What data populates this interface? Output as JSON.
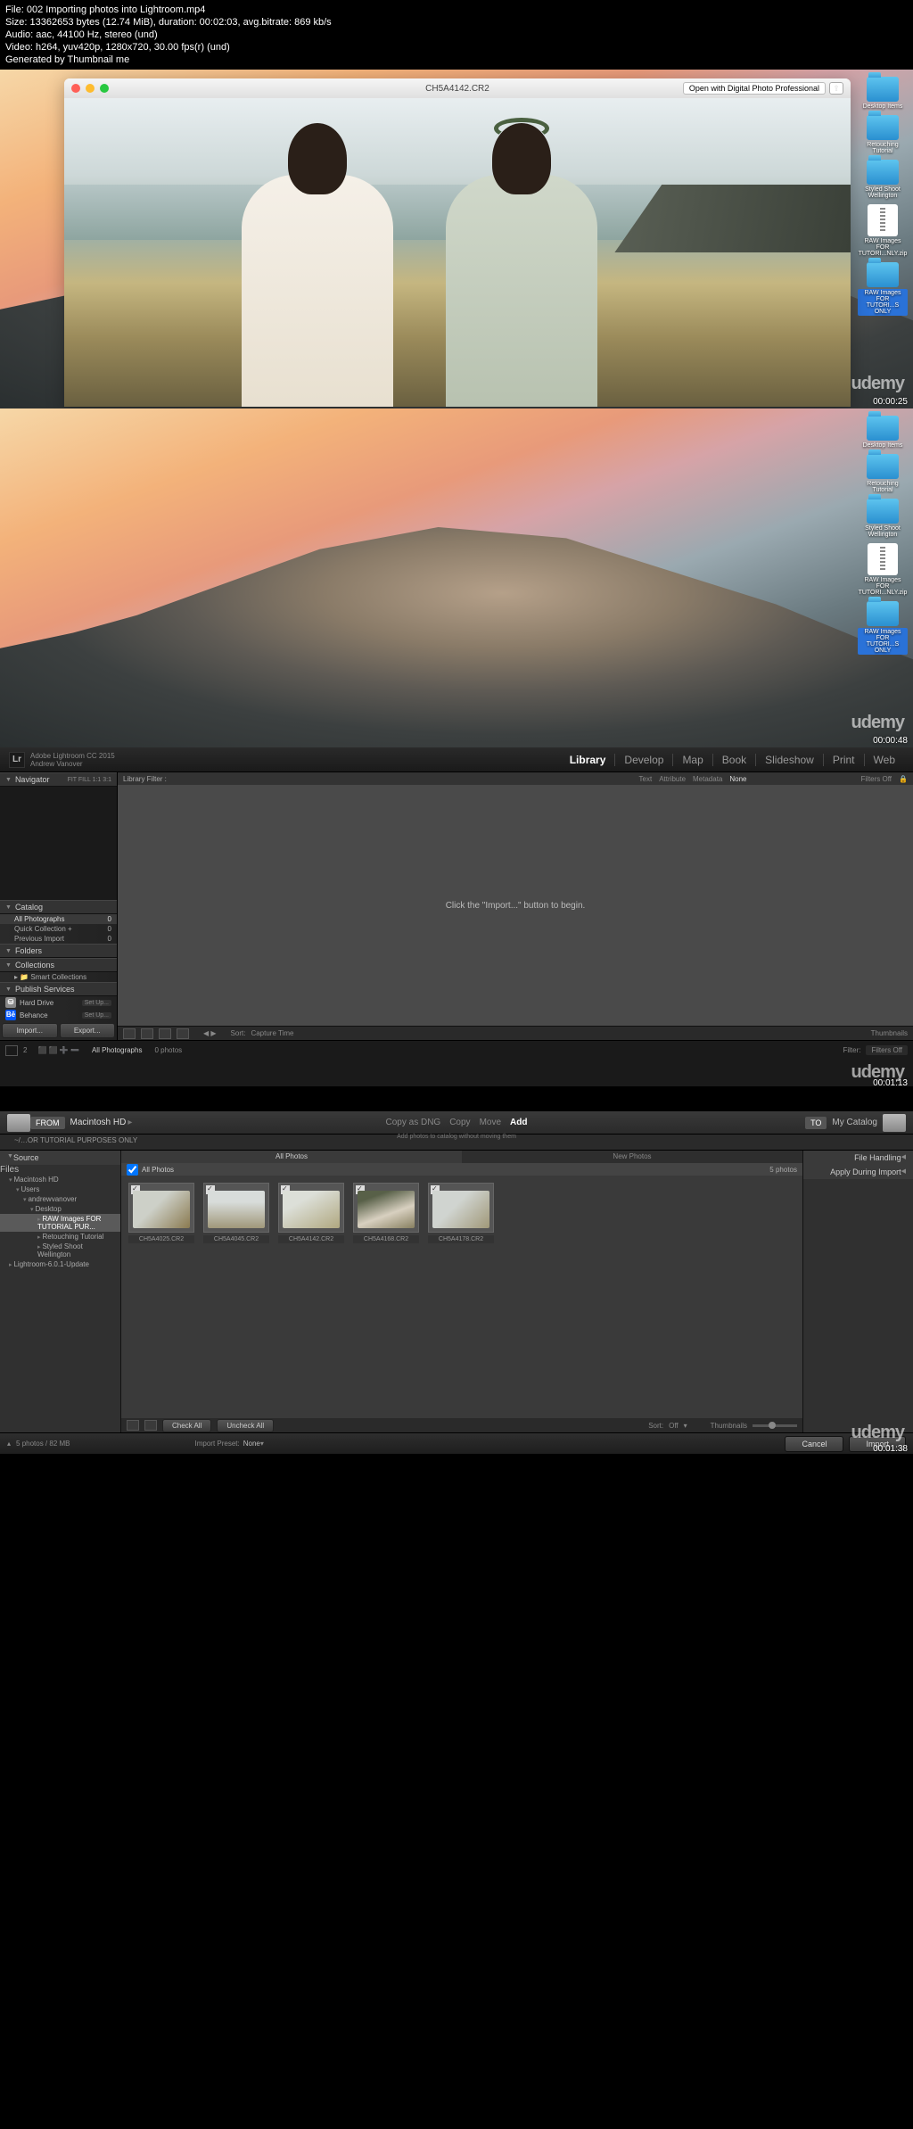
{
  "meta": {
    "file_line": "File: 002 Importing photos into Lightroom.mp4",
    "size_line": "Size: 13362653 bytes (12.74 MiB), duration: 00:02:03, avg.bitrate: 869 kb/s",
    "audio_line": "Audio: aac, 44100 Hz, stereo (und)",
    "video_line": "Video: h264, yuv420p, 1280x720, 30.00 fps(r) (und)",
    "gen_line": "Generated by Thumbnail me"
  },
  "watermark": "udemy",
  "shot1": {
    "preview_title": "CH5A4142.CR2",
    "open_with_btn": "Open with Digital Photo Professional",
    "timecode": "00:00:25",
    "desktop": [
      "Desktop Items",
      "Retouching Tutorial",
      "Styled Shoot Wellington",
      "RAW Images FOR TUTORI...NLY.zip",
      "RAW Images FOR TUTORI...S ONLY"
    ]
  },
  "shot2": {
    "timecode": "00:00:48",
    "desktop": [
      "Desktop Items",
      "Retouching Tutorial",
      "Styled Shoot Wellington",
      "RAW Images FOR TUTORI...NLY.zip",
      "RAW Images FOR TUTORI...S ONLY"
    ]
  },
  "lr": {
    "app_line1": "Adobe Lightroom CC 2015",
    "app_line2": "Andrew Vanover",
    "modules": [
      "Library",
      "Develop",
      "Map",
      "Book",
      "Slideshow",
      "Print",
      "Web"
    ],
    "active_module": "Library",
    "navigator": "Navigator",
    "nav_opts": "FIT   FILL   1:1   3:1",
    "filter_label": "Library Filter :",
    "filter_opts": [
      "Text",
      "Attribute",
      "Metadata",
      "None"
    ],
    "filter_right": "Filters Off",
    "grid_msg": "Click the \"Import...\" button to begin.",
    "catalog": {
      "hdr": "Catalog",
      "rows": [
        {
          "l": "All Photographs",
          "r": "0",
          "sel": true
        },
        {
          "l": "Quick Collection  +",
          "r": "0"
        },
        {
          "l": "Previous Import",
          "r": "0"
        }
      ]
    },
    "folders": "Folders",
    "collections": {
      "hdr": "Collections",
      "row": "Smart Collections"
    },
    "publish": {
      "hdr": "Publish Services",
      "rows": [
        {
          "icon": "⛁",
          "bg": "#888",
          "name": "Hard Drive",
          "setup": "Set Up..."
        },
        {
          "icon": "Bē",
          "bg": "#0057ff",
          "name": "Behance",
          "setup": "Set Up..."
        }
      ]
    },
    "import_btn": "Import...",
    "export_btn": "Export...",
    "toolbar": {
      "sort_lbl": "Sort:",
      "sort_val": "Capture Time",
      "thumb_lbl": "Thumbnails"
    },
    "filmstrip": {
      "path": "All Photographs",
      "count": "0 photos",
      "filter_lbl": "Filter:",
      "filter_val": "Filters Off"
    },
    "timecode": "00:01:13"
  },
  "imp": {
    "from_lbl": "FROM",
    "from_src": "Macintosh HD",
    "sub_path": "~/…OR TUTORIAL PURPOSES ONLY",
    "center_opts": [
      "Copy as DNG",
      "Copy",
      "Move",
      "Add"
    ],
    "center_active": "Add",
    "center_sub": "Add photos to catalog without moving them",
    "to_lbl": "TO",
    "to_dest": "My Catalog",
    "source_hdr": "Source",
    "files_hdr": "Files",
    "tree": [
      {
        "l": "Macintosh HD",
        "d": 0,
        "open": true
      },
      {
        "l": "Users",
        "d": 1,
        "open": true
      },
      {
        "l": "andrewvanover",
        "d": 2,
        "open": true
      },
      {
        "l": "Desktop",
        "d": 3,
        "open": true
      },
      {
        "l": "RAW Images FOR TUTORIAL PUR...",
        "d": 4,
        "sel": true
      },
      {
        "l": "Retouching Tutorial",
        "d": 4
      },
      {
        "l": "Styled Shoot Wellington",
        "d": 4
      },
      {
        "l": "Lightroom-6.0.1-Update",
        "d": 0
      }
    ],
    "right_panels": [
      "File Handling",
      "Apply During Import"
    ],
    "tabs": [
      "All Photos",
      "New Photos"
    ],
    "tabs_active": "All Photos",
    "allphotos_lbl": "All Photos",
    "photo_count": "5 photos",
    "thumbs": [
      {
        "name": "CH5A4025.CR2",
        "bg": "linear-gradient(135deg,#cdd0c8 40%,#8a7a50 100%)"
      },
      {
        "name": "CH5A4045.CR2",
        "bg": "linear-gradient(180deg,#d8dcda 30%,#a0987a 100%)"
      },
      {
        "name": "CH5A4142.CR2",
        "bg": "linear-gradient(150deg,#dcdfd8 30%,#b0a880 100%)"
      },
      {
        "name": "CH5A4168.CR2",
        "bg": "linear-gradient(160deg,#586048 20%,#d8d0c0 60%,#888060 100%)"
      },
      {
        "name": "CH5A4178.CR2",
        "bg": "linear-gradient(135deg,#d0d4d0 40%,#a09878 100%)"
      }
    ],
    "check_all": "Check All",
    "uncheck_all": "Uncheck All",
    "sort_lbl": "Sort:",
    "sort_val": "Off",
    "thumb_lbl": "Thumbnails",
    "foot_left": "5 photos / 82 MB",
    "preset_lbl": "Import Preset:",
    "preset_val": "None",
    "cancel": "Cancel",
    "import": "Import",
    "timecode": "00:01:38"
  }
}
